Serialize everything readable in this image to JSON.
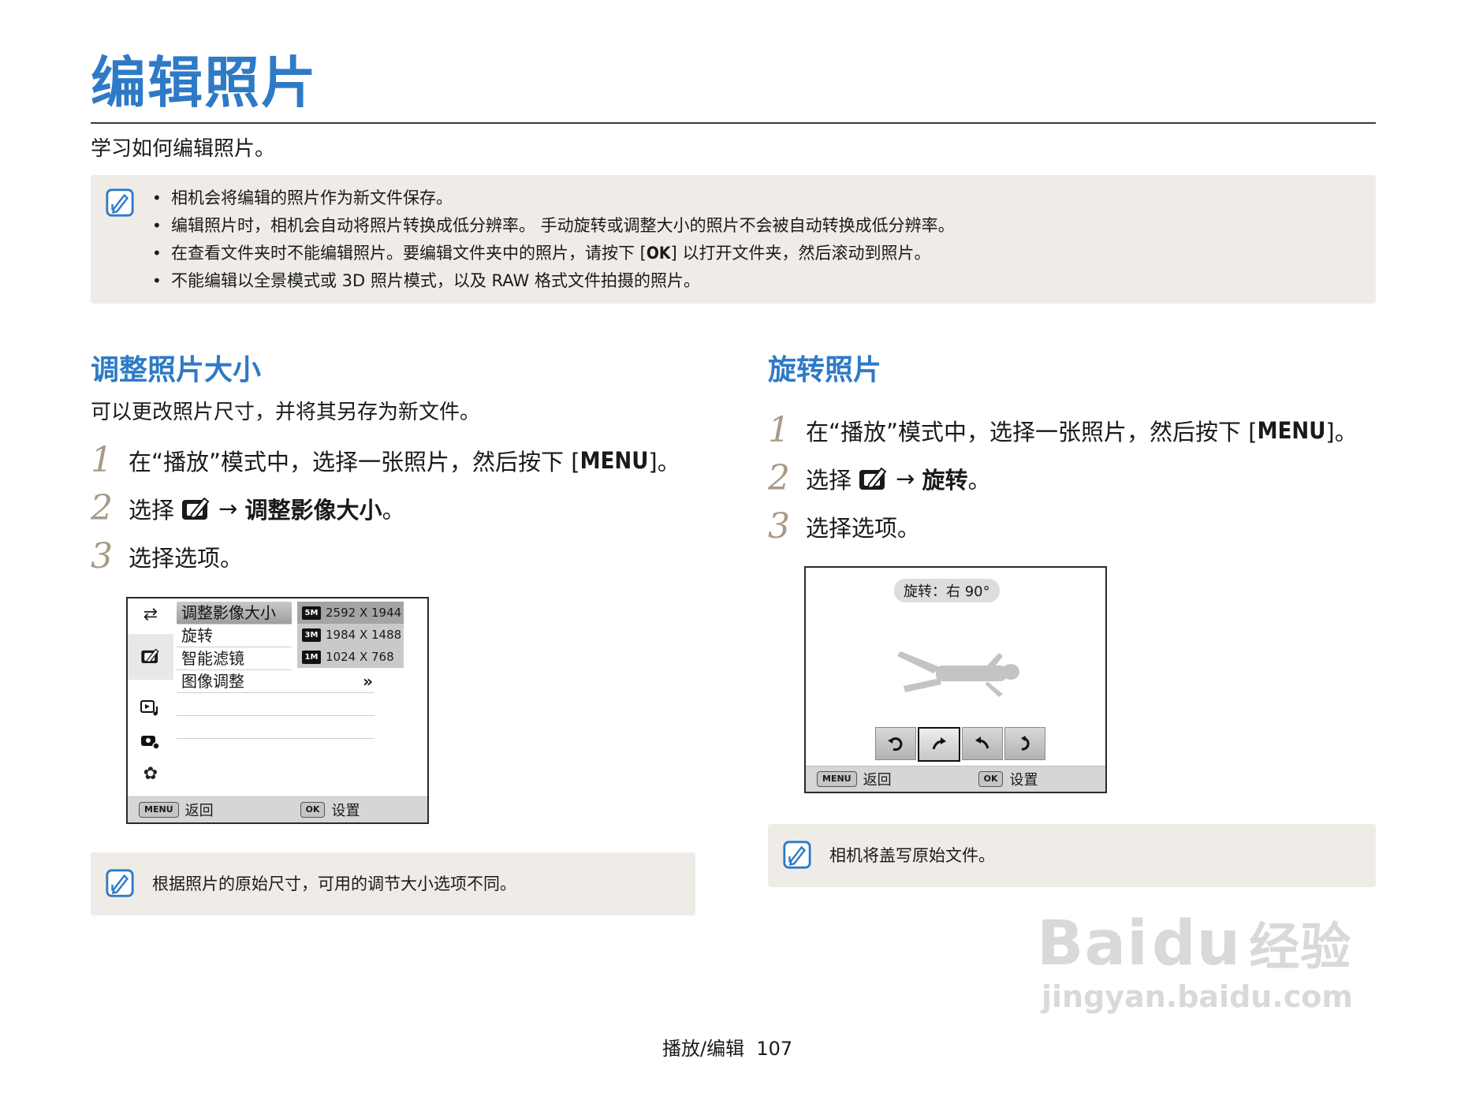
{
  "header": {
    "title": "编辑照片",
    "subtitle": "学习如何编辑照片。"
  },
  "top_note": {
    "icon": "note-pencil-icon",
    "items": [
      "相机会将编辑的照片作为新文件保存。",
      "编辑照片时，相机会自动将照片转换成低分辨率。 手动旋转或调整大小的照片不会被自动转换成低分辨率。",
      "在查看文件夹时不能编辑照片。要编辑文件夹中的照片，请按下 [",
      "不能编辑以全景模式或 3D 照片模式，以及 RAW 格式文件拍摄的照片。"
    ],
    "item3_key": "OK",
    "item3_rest": "] 以打开文件夹，然后滚动到照片。"
  },
  "resize": {
    "title": "调整照片大小",
    "lead": "可以更改照片尺寸，并将其另存为新文件。",
    "steps": [
      {
        "num": "1",
        "text_a": "在“播放”模式中，选择一张照片，然后按下 [",
        "key": "MENU",
        "text_b": "]。"
      },
      {
        "num": "2",
        "text_a": "选择",
        "arrow": "→",
        "target": "调整影像大小",
        "end": "。"
      },
      {
        "num": "3",
        "text_a": "选择选项。"
      }
    ],
    "screen": {
      "menu_items": [
        "调整影像大小",
        "旋转",
        "智能滤镜",
        "图像调整"
      ],
      "more": "»",
      "sizes": [
        {
          "icon": "5M",
          "label": "2592 X 1944"
        },
        {
          "icon": "3M",
          "label": "1984 X 1488"
        },
        {
          "icon": "1M",
          "label": "1024 X 768"
        }
      ],
      "back_tag": "MENU",
      "back_label": "返回",
      "ok_tag": "OK",
      "ok_label": "设置"
    },
    "note": "根据照片的原始尺寸，可用的调节大小选项不同。"
  },
  "rotate": {
    "title": "旋转照片",
    "steps": [
      {
        "num": "1",
        "text_a": "在“播放”模式中，选择一张照片，然后按下 [",
        "key": "MENU",
        "text_b": "]。"
      },
      {
        "num": "2",
        "text_a": "选择",
        "arrow": "→",
        "target": "旋转",
        "end": "。"
      },
      {
        "num": "3",
        "text_a": "选择选项。"
      }
    ],
    "screen": {
      "label": "旋转：右 90°",
      "back_tag": "MENU",
      "back_label": "返回",
      "ok_tag": "OK",
      "ok_label": "设置"
    },
    "note": "相机将盖写原始文件。"
  },
  "footer": {
    "section": "播放/编辑",
    "page": "107"
  },
  "watermark": {
    "main": "Bai",
    "paw": "du",
    "cn": "经验",
    "url": "jingyan.baidu.com"
  },
  "colors": {
    "accent": "#2e7ac6",
    "note_bg": "#efece7",
    "step_num": "#a89a86"
  }
}
